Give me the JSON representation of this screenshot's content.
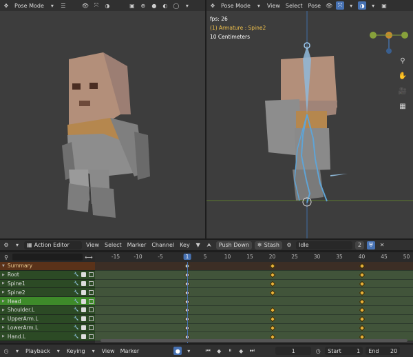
{
  "left_viewport": {
    "mode": "Pose Mode"
  },
  "right_viewport": {
    "mode": "Pose Mode",
    "menus": [
      "View",
      "Select",
      "Pose"
    ],
    "fps": "fps: 26",
    "armature": "(1) Armature : Spine2",
    "scale": "10 Centimeters",
    "gizmo_labels": {
      "z": "Z",
      "y": "Y",
      "x": "X"
    }
  },
  "action_editor": {
    "mode": "Action Editor",
    "menus": [
      "View",
      "Select",
      "Marker",
      "Channel",
      "Key"
    ],
    "push_down": "Push Down",
    "stash": "Stash",
    "action_name": "Idle",
    "users": "2"
  },
  "ruler": {
    "ticks": [
      "-15",
      "-10",
      "-5",
      "1",
      "5",
      "10",
      "15",
      "20",
      "25",
      "30",
      "35",
      "40",
      "45",
      "50"
    ],
    "current_frame": "1"
  },
  "channels": [
    {
      "name": "Summary",
      "type": "summary"
    },
    {
      "name": "Root",
      "type": "bone"
    },
    {
      "name": "Spine1",
      "type": "bone"
    },
    {
      "name": "Spine2",
      "type": "bone"
    },
    {
      "name": "Head",
      "type": "active"
    },
    {
      "name": "Shoulder.L",
      "type": "bone"
    },
    {
      "name": "UpperArm.L",
      "type": "bone"
    },
    {
      "name": "LowerArm.L",
      "type": "bone"
    },
    {
      "name": "Hand.L",
      "type": "bone"
    }
  ],
  "keyframes": {
    "Summary": [
      1,
      20,
      40
    ],
    "Root": [
      1,
      20,
      40
    ],
    "Spine1": [
      1,
      20,
      40
    ],
    "Spine2": [
      1,
      20,
      40
    ],
    "Head": [
      1,
      40
    ],
    "Shoulder.L": [
      1,
      20,
      40
    ],
    "UpperArm.L": [
      1,
      20,
      40
    ],
    "LowerArm.L": [
      1,
      20,
      40
    ],
    "Hand.L": [
      1,
      20,
      40
    ]
  },
  "timeline": {
    "menus": [
      "Playback",
      "Keying",
      "View",
      "Marker"
    ],
    "current_frame": "1",
    "start_label": "Start",
    "start": "1",
    "end_label": "End",
    "end": "20"
  },
  "colors": {
    "accent": "#4772b3",
    "keyframe": "#e8b23a",
    "channel_green": "#2c4a25",
    "active_channel": "#3e8a2a",
    "summary": "#5a3219"
  }
}
